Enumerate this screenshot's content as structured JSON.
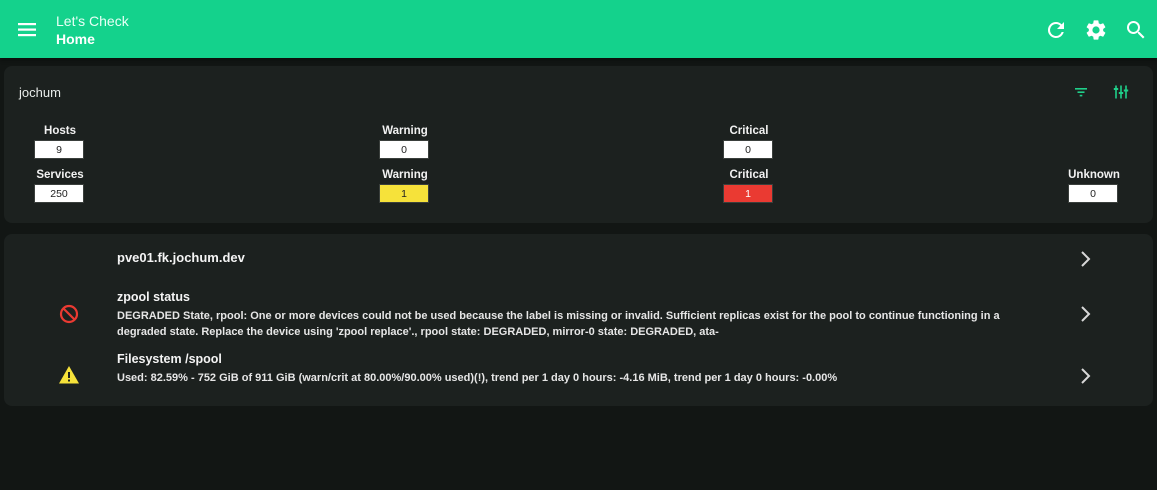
{
  "app": {
    "title": "Let's Check",
    "page": "Home"
  },
  "toolbar": {
    "icons": [
      "menu-icon",
      "refresh-icon",
      "settings-icon",
      "search-icon"
    ],
    "colors": {
      "appbar": "#14d28c",
      "background": "#121614",
      "card": "#1c211f"
    }
  },
  "summary": {
    "site": "jochum",
    "hosts": {
      "label": "Hosts",
      "value": "9"
    },
    "hosts_warning": {
      "label": "Warning",
      "value": "0"
    },
    "hosts_critical": {
      "label": "Critical",
      "value": "0"
    },
    "services": {
      "label": "Services",
      "value": "250"
    },
    "services_warning": {
      "label": "Warning",
      "value": "1",
      "color": "#f6e23a"
    },
    "services_critical": {
      "label": "Critical",
      "value": "1",
      "color": "#ea3a32"
    },
    "services_unknown": {
      "label": "Unknown",
      "value": "0"
    }
  },
  "host": {
    "name": "pve01.fk.jochum.dev",
    "services": [
      {
        "title": "zpool status",
        "state": "critical",
        "icon": "block-icon",
        "text": "DEGRADED State, rpool: One or more devices could not be used because the label is missing or invalid. Sufficient replicas exist for the pool to continue functioning in a degraded state. Replace the device using 'zpool replace'., rpool state: DEGRADED, mirror-0 state: DEGRADED, ata-"
      },
      {
        "title": "Filesystem /spool",
        "state": "warning",
        "icon": "warning-icon",
        "text": "Used: 82.59% - 752 GiB of 911 GiB (warn/crit at 80.00%/90.00% used)(!), trend per 1 day 0 hours: -4.16 MiB, trend per 1 day 0 hours: -0.00%"
      }
    ]
  }
}
